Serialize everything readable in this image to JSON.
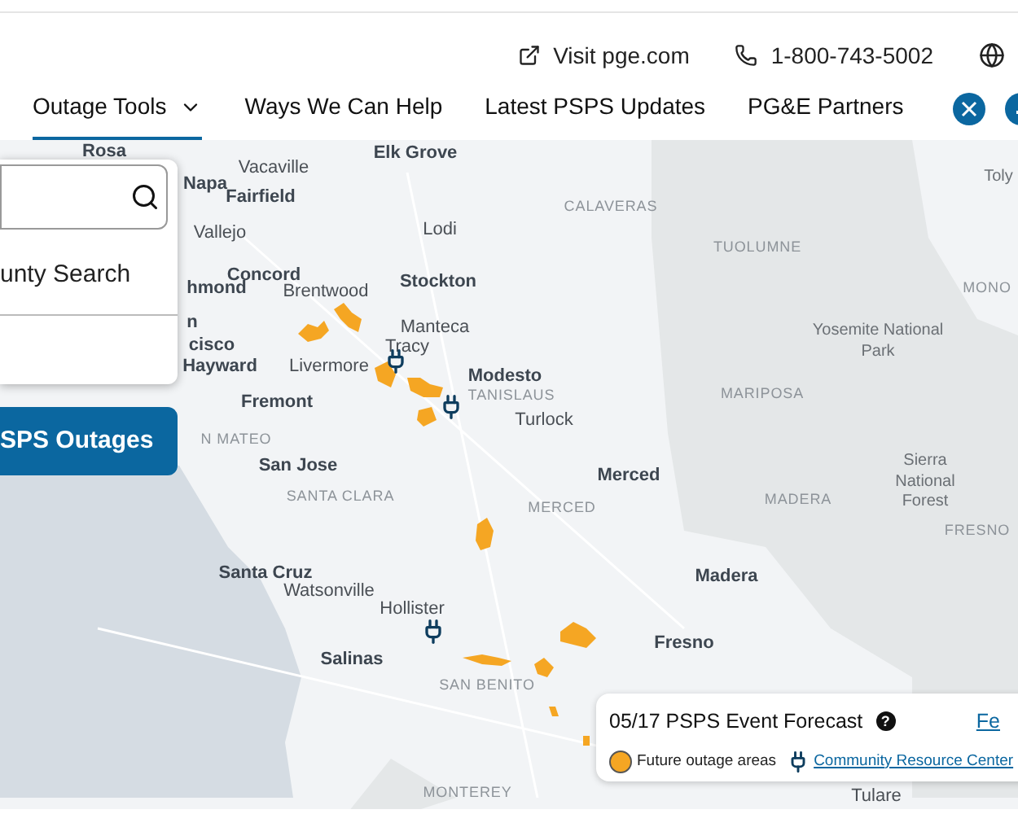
{
  "utility_links": [
    {
      "kind": "external",
      "label": "Visit pge.com"
    },
    {
      "kind": "phone",
      "label": "1-800-743-5002"
    }
  ],
  "nav": [
    {
      "label": "Outage Tools",
      "selected": true,
      "dropdown": true
    },
    {
      "label": "Ways We Can Help",
      "selected": false,
      "dropdown": false
    },
    {
      "label": "Latest PSPS Updates",
      "selected": false,
      "dropdown": false
    },
    {
      "label": "PG&E Partners",
      "selected": false,
      "dropdown": false
    }
  ],
  "panel": {
    "option": "unty Search",
    "button": "SPS Outages"
  },
  "map": {
    "labels": [
      {
        "text": "Rosa",
        "kind": "city"
      },
      {
        "text": "Vacaville",
        "kind": "town"
      },
      {
        "text": "Elk Grove",
        "kind": "city"
      },
      {
        "text": "Napa",
        "kind": "city"
      },
      {
        "text": "Fairfield",
        "kind": "city"
      },
      {
        "text": "Vallejo",
        "kind": "town"
      },
      {
        "text": "Lodi",
        "kind": "town"
      },
      {
        "text": "CALAVERAS",
        "kind": "county"
      },
      {
        "text": "TUOLUMNE",
        "kind": "county"
      },
      {
        "text": "Toly",
        "kind": "park"
      },
      {
        "text": "Concord",
        "kind": "city"
      },
      {
        "text": "hmond",
        "kind": "city"
      },
      {
        "text": "Brentwood",
        "kind": "town"
      },
      {
        "text": "Stockton",
        "kind": "city"
      },
      {
        "text": "MONO",
        "kind": "county"
      },
      {
        "text": "n",
        "kind": "city"
      },
      {
        "text": "Manteca",
        "kind": "town"
      },
      {
        "text": "cisco",
        "kind": "city"
      },
      {
        "text": "Tracy",
        "kind": "town"
      },
      {
        "text": "Yosemite National Park",
        "kind": "park"
      },
      {
        "text": "Hayward",
        "kind": "city"
      },
      {
        "text": "Livermore",
        "kind": "town"
      },
      {
        "text": "Modesto",
        "kind": "city"
      },
      {
        "text": "TANISLAUS",
        "kind": "county"
      },
      {
        "text": "Fremont",
        "kind": "city"
      },
      {
        "text": "MARIPOSA",
        "kind": "county"
      },
      {
        "text": "Turlock",
        "kind": "town"
      },
      {
        "text": "N MATEO",
        "kind": "county"
      },
      {
        "text": "San Jose",
        "kind": "city"
      },
      {
        "text": "Merced",
        "kind": "city"
      },
      {
        "text": "SANTA CLARA",
        "kind": "county"
      },
      {
        "text": "MERCED",
        "kind": "county"
      },
      {
        "text": "MADERA",
        "kind": "county"
      },
      {
        "text": "Sierra National Forest",
        "kind": "park"
      },
      {
        "text": "FRESNO",
        "kind": "county"
      },
      {
        "text": "Santa Cruz",
        "kind": "city"
      },
      {
        "text": "Watsonville",
        "kind": "town"
      },
      {
        "text": "Madera",
        "kind": "city"
      },
      {
        "text": "Hollister",
        "kind": "town"
      },
      {
        "text": "Fresno",
        "kind": "city"
      },
      {
        "text": "Salinas",
        "kind": "city"
      },
      {
        "text": "SAN BENITO",
        "kind": "county"
      },
      {
        "text": "MONTEREY",
        "kind": "county"
      },
      {
        "text": "Tulare",
        "kind": "town"
      }
    ]
  },
  "legend": {
    "title": "05/17 PSPS Event Forecast",
    "help": "?",
    "link": "Fe",
    "items": [
      {
        "kind": "outage",
        "label": "Future outage areas",
        "link": false
      },
      {
        "kind": "resource",
        "label": "Community Resource Center",
        "link": true
      }
    ]
  }
}
